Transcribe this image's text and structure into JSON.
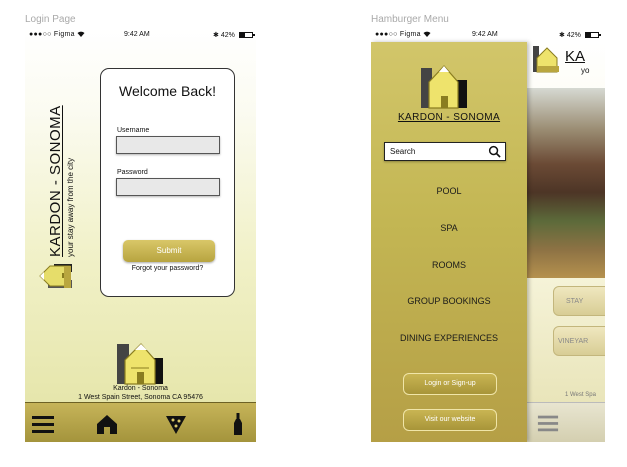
{
  "frames": {
    "login_label": "Login Page",
    "menu_label": "Hamburger Menu"
  },
  "status_bar": {
    "signal": "●●●○○ Figma ",
    "wifi_icon": "wifi-icon",
    "time": "9:42 AM",
    "battery_text": "42%",
    "bluetooth": "✱"
  },
  "brand": {
    "name": "KARDON - SONOMA",
    "tagline": "your stay away from the city",
    "logo_small_caption": "Sonoma",
    "footer_name": "Kardon - Sonoma",
    "address": "1 West Spain Street, Sonoma CA 95476"
  },
  "login": {
    "title": "Welcome Back!",
    "username_label": "Username",
    "username_value": "",
    "password_label": "Password",
    "password_value": "",
    "submit_label": "Submit",
    "forgot_label": "Forgot your password?"
  },
  "tabbar": {
    "items": [
      "menu-icon",
      "home-icon",
      "pizza-icon",
      "wine-bottle-icon"
    ]
  },
  "menu": {
    "brand": "KARDON - SONOMA",
    "search_label": "Search",
    "items": [
      "POOL",
      "SPA",
      "ROOMS",
      "GROUP BOOKINGS",
      "DINING EXPERIENCES"
    ],
    "login_button": "Login or Sign-up",
    "website_button": "Visit our website",
    "behind_header": "KA",
    "behind_header_sub": "yo",
    "behind_btn_1": "STAY",
    "behind_btn_2": "VINEYAR",
    "behind_address": "1 West Spa"
  },
  "colors": {
    "gold": "#c3b653",
    "gold_dark": "#a4943c"
  }
}
